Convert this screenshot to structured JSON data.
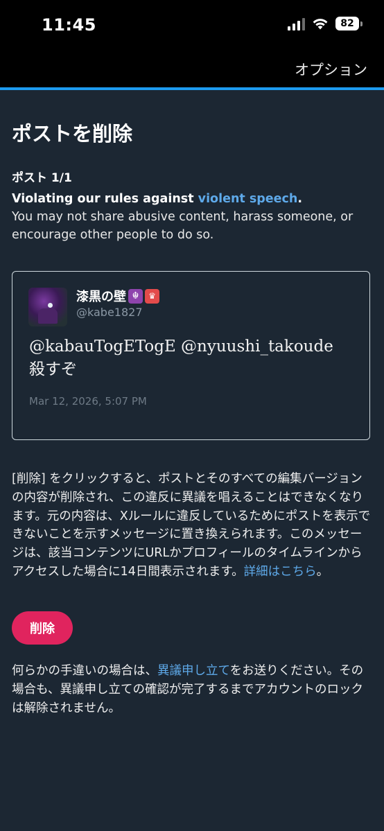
{
  "status_bar": {
    "time": "11:45",
    "battery": "82"
  },
  "nav": {
    "options_label": "オプション"
  },
  "page": {
    "title": "ポストを削除",
    "post_count": "ポスト 1/1",
    "rule_prefix": "Violating our rules against ",
    "rule_link": "violent speech",
    "rule_suffix": ".",
    "rule_description": "You may not share abusive content, harass someone, or encourage other people to do so."
  },
  "post": {
    "display_name": "漆黒の壁",
    "badge1": "☬",
    "badge2": "♛",
    "handle": "@kabe1827",
    "text_line1": "@kabauTogETogE @nyuushi_takoude",
    "text_line2": "殺すぞ",
    "date": "Mar 12, 2026, 5:07 PM"
  },
  "explanation": {
    "text": "[削除] をクリックすると、ポストとそのすべての編集バージョンの内容が削除され、この違反に異議を唱えることはできなくなります。元の内容は、Xルールに違反しているためにポストを表示できないことを示すメッセージに置き換えられます。このメッセージは、該当コンテンツにURLかプロフィールのタイムラインからアクセスした場合に14日間表示されます。",
    "link": "詳細はこちら",
    "suffix": "。"
  },
  "delete_button": {
    "label": "削除"
  },
  "appeal": {
    "prefix": "何らかの手違いの場合は、",
    "link": "異議申し立て",
    "suffix": "をお送りください。その場合も、異議申し立ての確認が完了するまでアカウントのロックは解除されません。"
  },
  "colors": {
    "accent": "#1d9bf0",
    "link": "#5ea9e9",
    "danger": "#e0245e",
    "background": "#1c2733"
  }
}
